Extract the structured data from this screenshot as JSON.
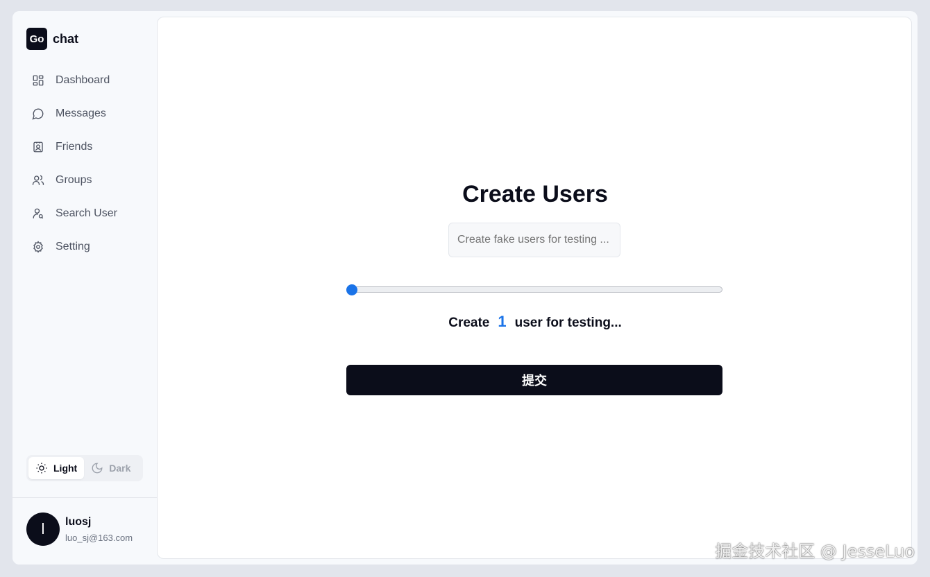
{
  "brand": {
    "logo": "Go",
    "name": "chat"
  },
  "sidebar": {
    "items": [
      {
        "label": "Dashboard",
        "icon": "dashboard-icon"
      },
      {
        "label": "Messages",
        "icon": "message-circle-icon"
      },
      {
        "label": "Friends",
        "icon": "contact-card-icon"
      },
      {
        "label": "Groups",
        "icon": "users-icon"
      },
      {
        "label": "Search User",
        "icon": "user-search-icon"
      },
      {
        "label": "Setting",
        "icon": "gear-icon"
      }
    ]
  },
  "theme": {
    "light_label": "Light",
    "dark_label": "Dark",
    "selected": "Light"
  },
  "user": {
    "initial": "l",
    "name": "luosj",
    "email": "luo_sj@163.com"
  },
  "main": {
    "title": "Create Users",
    "description_placeholder": "Create fake users for testing ...",
    "slider_value": 1,
    "slider_fraction": 0,
    "count_prefix": "Create",
    "count_value": "1",
    "count_suffix": "user for testing...",
    "submit_label": "提交"
  },
  "watermark": "掘金技术社区 @ JesseLuo",
  "colors": {
    "accent": "#1a73e8",
    "primary": "#0b0d1a",
    "background": "#f7f9fc"
  }
}
